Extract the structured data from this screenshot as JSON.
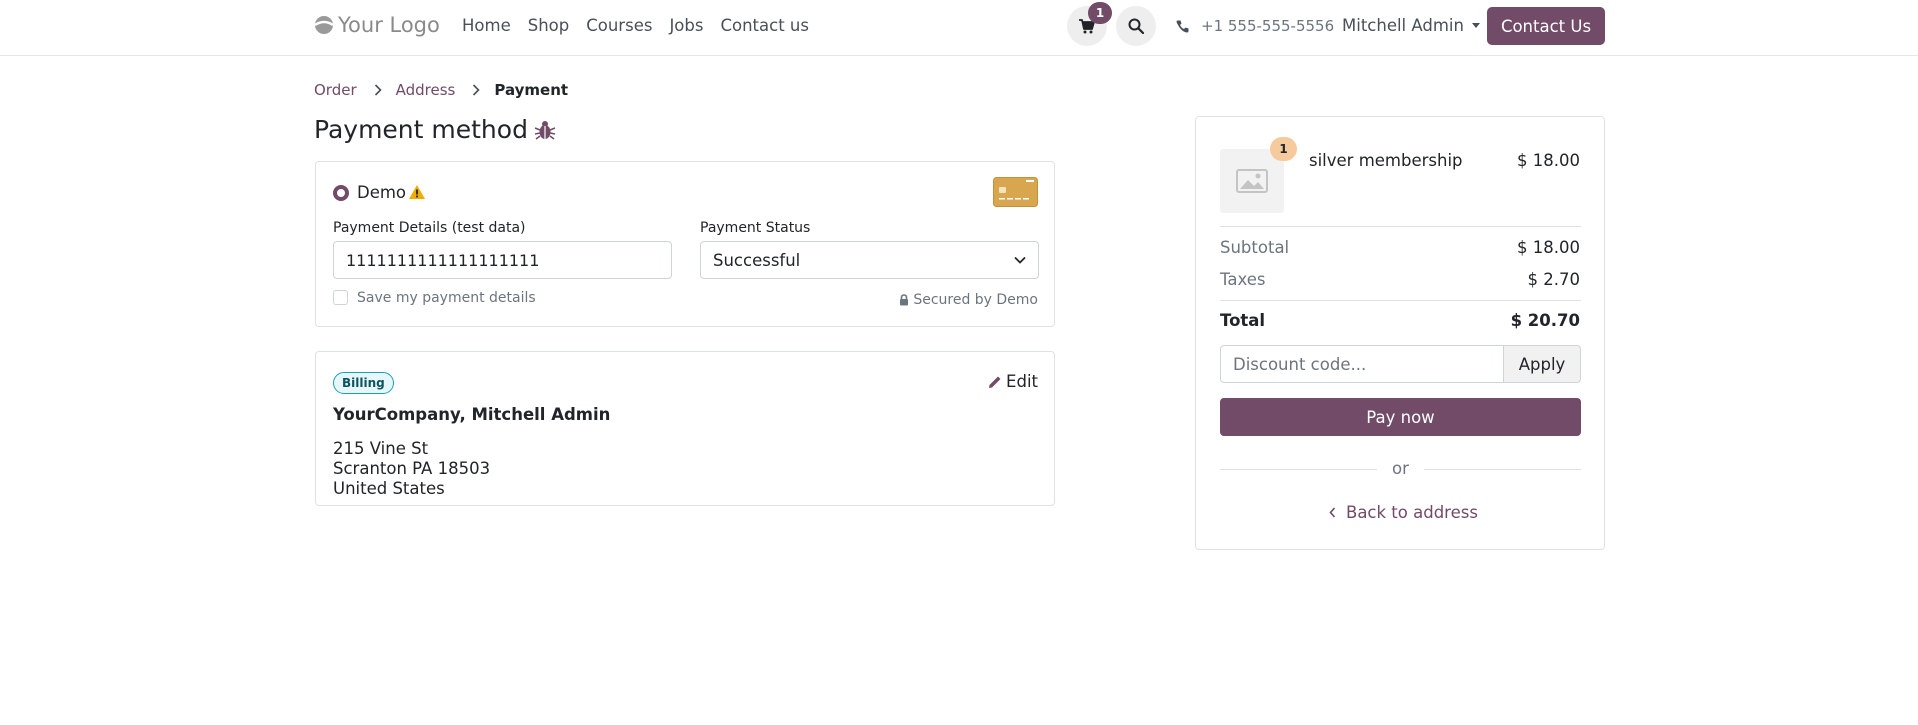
{
  "header": {
    "logo_text": "Your Logo",
    "nav": [
      "Home",
      "Shop",
      "Courses",
      "Jobs",
      "Contact us"
    ],
    "cart_count": "1",
    "phone": "+1 555-555-5556",
    "user": "Mitchell Admin",
    "contact_button": "Contact Us"
  },
  "breadcrumb": {
    "step1": "Order",
    "step2": "Address",
    "step3": "Payment"
  },
  "payment": {
    "title": "Payment method",
    "provider": "Demo",
    "details_label": "Payment Details (test data)",
    "card_number": "1111111111111111111",
    "status_label": "Payment Status",
    "status_value": "Successful",
    "save_label": "Save my payment details",
    "secured_text": "Secured by Demo"
  },
  "billing": {
    "badge": "Billing",
    "edit_label": "Edit",
    "company": "YourCompany, Mitchell Admin",
    "address_line1": "215 Vine St",
    "address_line2": "Scranton PA 18503",
    "address_line3": "United States"
  },
  "summary": {
    "quantity": "1",
    "product": "silver membership",
    "product_price": "$ 18.00",
    "subtotal_label": "Subtotal",
    "subtotal_value": "$ 18.00",
    "taxes_label": "Taxes",
    "taxes_value": "$ 2.70",
    "total_label": "Total",
    "total_value": "$ 20.70",
    "discount_placeholder": "Discount code...",
    "apply_label": "Apply",
    "pay_label": "Pay now",
    "or_text": "or",
    "back_label": "Back to address"
  },
  "colors": {
    "primary": "#714b67",
    "badge_qty": "#f5cb9e",
    "warning": "#f0ad00",
    "card": "#d8a64e"
  }
}
